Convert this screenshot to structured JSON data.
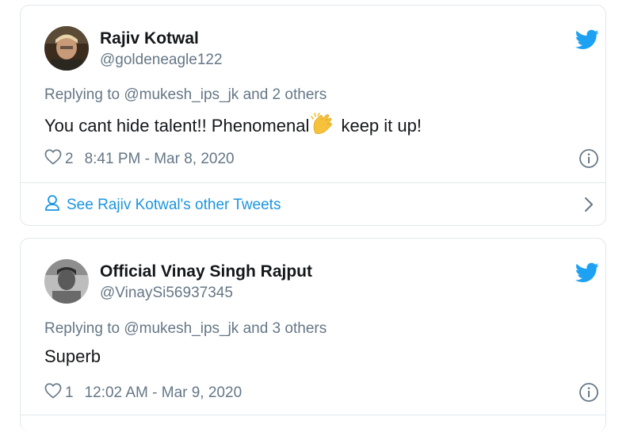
{
  "tweets": [
    {
      "author_name": "Rajiv Kotwal",
      "author_handle": "@goldeneagle122",
      "replying_prefix": "Replying to ",
      "replying_link": "@mukesh_ips_jk and 2 others",
      "text_before": "You cant hide talent!! Phenomenal",
      "emoji": "clapping-hands",
      "text_after": " keep it up!",
      "likes": "2",
      "timestamp": "8:41 PM - Mar 8, 2020",
      "see_more": "See Rajiv Kotwal's other Tweets"
    },
    {
      "author_name": "Official Vinay Singh Rajput",
      "author_handle": "@VinaySi56937345",
      "replying_prefix": "Replying to ",
      "replying_link": "@mukesh_ips_jk and 3 others",
      "text": "Superb",
      "likes": "1",
      "timestamp": "12:02 AM - Mar 9, 2020"
    }
  ],
  "colors": {
    "twitter_blue": "#1da1f2",
    "link_blue": "#1b95e0",
    "muted_gray": "#657786",
    "border": "#e1e8ed"
  },
  "icons": [
    "twitter-bird-icon",
    "heart-icon",
    "info-icon",
    "person-icon",
    "chevron-right-icon",
    "clapping-hands-icon"
  ]
}
